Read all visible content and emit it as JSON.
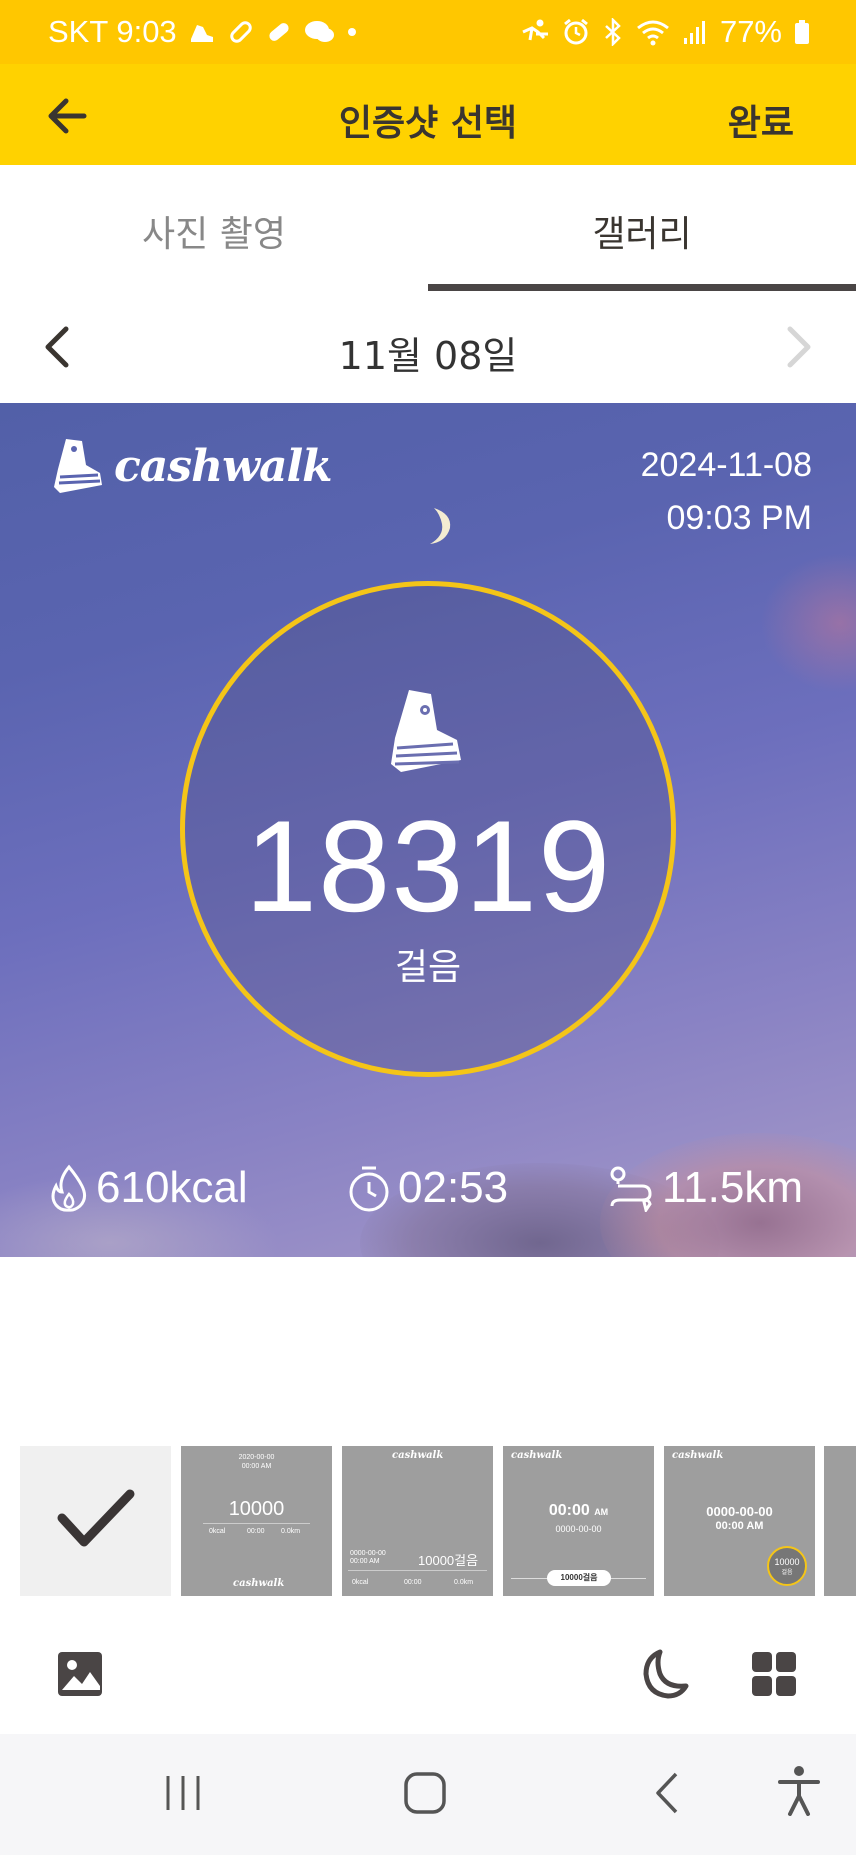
{
  "status_bar": {
    "carrier_time": "SKT 9:03",
    "battery": "77%",
    "left_icons": [
      "cashwalk-notify-icon",
      "link-icon",
      "pill-icon",
      "chat-icon",
      "dot-icon"
    ],
    "right_icons": [
      "activity-icon",
      "alarm-icon",
      "bluetooth-icon",
      "wifi-icon",
      "signal-icon",
      "battery-icon"
    ]
  },
  "app_bar": {
    "title": "인증샷 선택",
    "done_label": "완료",
    "back_icon": "back-arrow-icon"
  },
  "tabs": [
    {
      "label": "사진 촬영",
      "active": false
    },
    {
      "label": "갤러리",
      "active": true
    }
  ],
  "date_nav": {
    "date": "11월 08일"
  },
  "photo": {
    "brand": "cashwalk",
    "date": "2024-11-08",
    "time": "09:03 PM",
    "steps": "18319",
    "steps_unit": "걸음",
    "calories": "610kcal",
    "duration": "02:53",
    "distance": "11.5km",
    "ring_color": "#f4c518"
  },
  "thumbnails": [
    {
      "type": "none",
      "selected": true
    },
    {
      "type": "center",
      "date": "2020-00-00",
      "time": "00:00 AM",
      "steps": "10000",
      "kcal": "0kcal",
      "duration": "00:00",
      "dist": "0.0km",
      "brand": "cashwalk"
    },
    {
      "type": "bottom",
      "brand": "cashwalk",
      "date": "0000-00-00",
      "time": "00:00 AM",
      "steps": "10000걸음",
      "kcal": "0kcal",
      "duration": "00:00",
      "dist": "0.0km"
    },
    {
      "type": "clock",
      "brand": "cashwalk",
      "time": "00:00",
      "ampm": "AM",
      "date": "0000-00-00",
      "steps": "10000걸음"
    },
    {
      "type": "badge",
      "brand": "cashwalk",
      "date": "0000-00-00",
      "time": "00:00 AM",
      "steps": "10000",
      "unit": "걸음"
    }
  ],
  "toolbar": {
    "gallery_icon": "image-icon",
    "night_icon": "moon-icon",
    "grid_icon": "grid-icon"
  },
  "accent": "#ffd200"
}
